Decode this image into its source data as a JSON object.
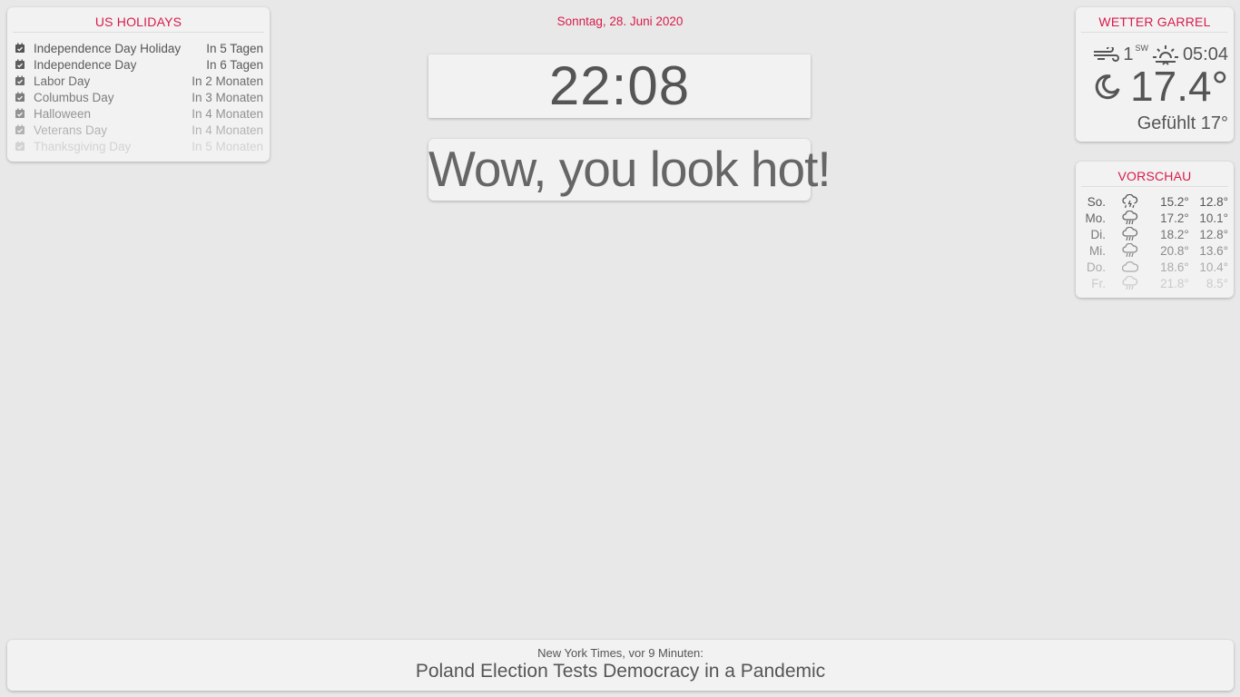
{
  "holidays": {
    "title": "US HOLIDAYS",
    "items": [
      {
        "name": "Independence Day Holiday",
        "when": "In 5 Tagen"
      },
      {
        "name": "Independence Day",
        "when": "In 6 Tagen"
      },
      {
        "name": "Labor Day",
        "when": "In 2 Monaten"
      },
      {
        "name": "Columbus Day",
        "when": "In 3 Monaten"
      },
      {
        "name": "Halloween",
        "when": "In 4 Monaten"
      },
      {
        "name": "Veterans Day",
        "when": "In 4 Monaten"
      },
      {
        "name": "Thanksgiving Day",
        "when": "In 5 Monaten"
      }
    ],
    "icon": "calendar-check-icon"
  },
  "date": "Sonntag, 28. Juni 2020",
  "clock": {
    "time": "22:08"
  },
  "compliment": "Wow, you look hot!",
  "weather": {
    "title": "WETTER GARREL",
    "wind_speed": "1",
    "wind_dir": "SW",
    "sunrise": "05:04",
    "temperature": "17.4°",
    "feels_like": "Gefühlt 17°",
    "icons": {
      "wind": "wind-icon",
      "sun": "sunrise-icon",
      "cond": "night-crescent-icon"
    }
  },
  "forecast": {
    "title": "VORSCHAU",
    "days": [
      {
        "day": "So.",
        "max": "15.2°",
        "min": "12.8°",
        "icon": "thunderstorm-icon"
      },
      {
        "day": "Mo.",
        "max": "17.2°",
        "min": "10.1°",
        "icon": "rain-icon"
      },
      {
        "day": "Di.",
        "max": "18.2°",
        "min": "12.8°",
        "icon": "rain-icon"
      },
      {
        "day": "Mi.",
        "max": "20.8°",
        "min": "13.6°",
        "icon": "rain-icon"
      },
      {
        "day": "Do.",
        "max": "18.6°",
        "min": "10.4°",
        "icon": "cloud-icon"
      },
      {
        "day": "Fr.",
        "max": "21.8°",
        "min": "8.5°",
        "icon": "rain-icon"
      }
    ]
  },
  "news": {
    "source": "New York Times, vor 9 Minuten:",
    "headline": "Poland Election Tests Democracy in a Pandemic"
  },
  "colors": {
    "accent": "#d81b4a",
    "background": "#e8e8e8",
    "card": "#f2f2f2",
    "text": "#555555"
  }
}
